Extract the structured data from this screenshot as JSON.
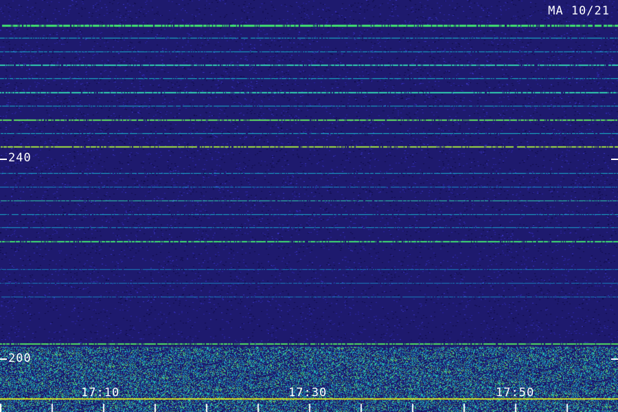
{
  "header": {
    "station_label": "MA 10/21"
  },
  "y_axis": {
    "tick_labels": [
      "240",
      "200"
    ]
  },
  "x_axis": {
    "tick_labels": [
      "17:10",
      "17:30",
      "17:50"
    ]
  },
  "colors": {
    "background": "#1e1a6e",
    "noise_dark": "#0f0c4a",
    "noise_mid": "#2d27a8",
    "line_cyan": "#18b8d0",
    "line_green": "#40e080",
    "line_yellow": "#d8e020",
    "axis": "#ffffff"
  }
}
